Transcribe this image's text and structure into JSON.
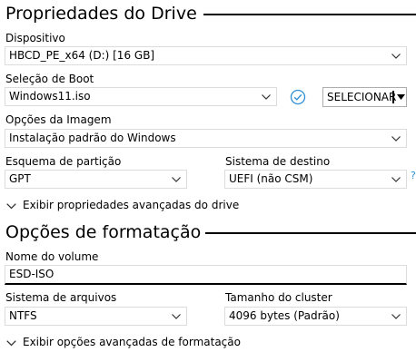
{
  "drive_properties": {
    "title": "Propriedades do Drive",
    "device_label": "Dispositivo",
    "device_value": "HBCD_PE_x64 (D:) [16 GB]",
    "boot_selection_label": "Seleção de Boot",
    "boot_selection_value": "Windows11.iso",
    "select_button_label": "SELECIONAR",
    "image_options_label": "Opções da Imagem",
    "image_options_value": "Instalação padrão do Windows",
    "partition_scheme_label": "Esquema de partição",
    "partition_scheme_value": "GPT",
    "target_system_label": "Sistema de destino",
    "target_system_value": "UEFI (não CSM)",
    "help_mark": "?",
    "advanced_toggle_label": "Exibir propriedades avançadas do drive"
  },
  "format_options": {
    "title": "Opções de formatação",
    "volume_label_label": "Nome do volume",
    "volume_label_value": "ESD-ISO",
    "file_system_label": "Sistema de arquivos",
    "file_system_value": "NTFS",
    "cluster_size_label": "Tamanho do cluster",
    "cluster_size_value": "4096 bytes (Padrão)",
    "advanced_toggle_label": "Exibir opções avançadas de formatação"
  },
  "icons": {
    "dropdown": "chevron-down-icon",
    "verify": "check-circle-icon",
    "split": "caret-down-icon",
    "expand": "chevron-down-icon"
  },
  "colors": {
    "accent": "#2c8fd6",
    "text": "#000000",
    "border": "#dcdcdc"
  }
}
